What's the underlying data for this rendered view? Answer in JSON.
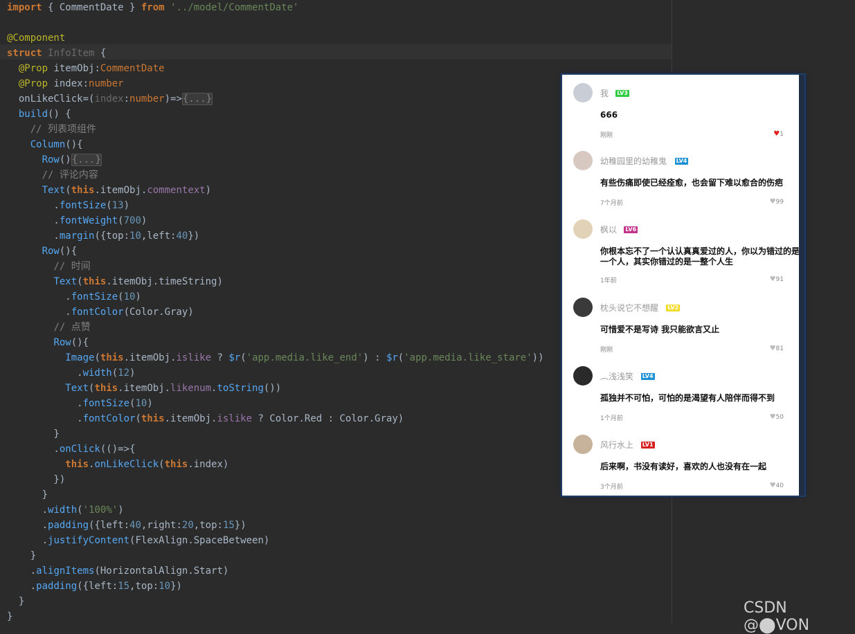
{
  "code_lines": [
    [
      "kw:import",
      " { CommentDate } ",
      "kw:from",
      " ",
      "str:'../model/CommentDate'"
    ],
    [
      ""
    ],
    [
      "ann:@Component"
    ],
    [
      "kw:struct",
      " ",
      "dim:InfoItem",
      " {"
    ],
    [
      "  ",
      "ann:@Prop",
      " itemObj:",
      "type:CommentDate"
    ],
    [
      "  ",
      "ann:@Prop",
      " index:",
      "type:number"
    ],
    [
      "  onLikeClick=(",
      "dim:index",
      ":",
      "type:number",
      ")=>",
      "fold:{...}"
    ],
    [
      "  ",
      "fn:build",
      "() {"
    ],
    [
      "    ",
      "cmt:// 列表项组件"
    ],
    [
      "    ",
      "fn:Column",
      "(){"
    ],
    [
      "      ",
      "fn:Row",
      "()",
      "fold:{...}"
    ],
    [
      "      ",
      "cmt:// 评论内容"
    ],
    [
      "      ",
      "fn:Text",
      "(",
      "kw:this",
      ".itemObj.",
      "prop:commentext",
      ")"
    ],
    [
      "        .",
      "meth:fontSize",
      "(",
      "num:13",
      ")"
    ],
    [
      "        .",
      "meth:fontWeight",
      "(",
      "num:700",
      ")"
    ],
    [
      "        .",
      "meth:margin",
      "({top:",
      "num:10",
      ",left:",
      "num:40",
      "})"
    ],
    [
      "      ",
      "fn:Row",
      "(){"
    ],
    [
      "        ",
      "cmt:// 时间"
    ],
    [
      "        ",
      "fn:Text",
      "(",
      "kw:this",
      ".itemObj.timeString)"
    ],
    [
      "          .",
      "meth:fontSize",
      "(",
      "num:10",
      ")"
    ],
    [
      "          .",
      "meth:fontColor",
      "(Color.Gray)"
    ],
    [
      "        ",
      "cmt:// 点赞"
    ],
    [
      "        ",
      "fn:Row",
      "(){"
    ],
    [
      "          ",
      "fn:Image",
      "(",
      "kw:this",
      ".itemObj.",
      "prop:islike",
      " ? ",
      "fn:$r",
      "(",
      "str:'app.media.like_end'",
      ") : ",
      "fn:$r",
      "(",
      "str:'app.media.like_stare'",
      "))"
    ],
    [
      "            .",
      "meth:width",
      "(",
      "num:12",
      ")"
    ],
    [
      "          ",
      "fn:Text",
      "(",
      "kw:this",
      ".itemObj.",
      "prop:likenum",
      ".",
      "meth:toString",
      "())"
    ],
    [
      "            .",
      "meth:fontSize",
      "(",
      "num:10",
      ")"
    ],
    [
      "            .",
      "meth:fontColor",
      "(",
      "kw:this",
      ".itemObj.",
      "prop:islike",
      " ? Color.Red : Color.Gray)"
    ],
    [
      "        }"
    ],
    [
      "        .",
      "meth:onClick",
      "(()=>{"
    ],
    [
      "          ",
      "kw:this",
      ".",
      "meth:onLikeClick",
      "(",
      "kw:this",
      ".index)"
    ],
    [
      "        })"
    ],
    [
      "      }"
    ],
    [
      "      .",
      "meth:width",
      "(",
      "str:'100%'",
      ")"
    ],
    [
      "      .",
      "meth:padding",
      "({left:",
      "num:40",
      ",right:",
      "num:20",
      ",top:",
      "num:15",
      "})"
    ],
    [
      "      .",
      "meth:justifyContent",
      "(FlexAlign.SpaceBetween)"
    ],
    [
      "    }"
    ],
    [
      "    .",
      "meth:alignItems",
      "(HorizontalAlign.Start)"
    ],
    [
      "    .",
      "meth:padding",
      "({left:",
      "num:15",
      ",top:",
      "num:10",
      "})"
    ],
    [
      "  }"
    ],
    [
      "}"
    ]
  ],
  "comments": [
    {
      "name": "我",
      "level": "LV3",
      "level_color": "#2ecc40",
      "text": "666",
      "time": "刚刚",
      "likes": "1",
      "liked": true,
      "avatar": "#c9cdd6"
    },
    {
      "name": "幼稚园里的幼稚鬼",
      "level": "LV4",
      "level_color": "#1e90d6",
      "text": "有些伤痛即使已经痊愈，也会留下难以愈合的伤疤",
      "time": "7个月前",
      "likes": "99",
      "liked": false,
      "avatar": "#d8c8c2"
    },
    {
      "name": "枫以",
      "level": "LV6",
      "level_color": "#c2328a",
      "text": "你根本忘不了一个认认真真爱过的人，你以为错过的是一个人，其实你错过的是一整个人生",
      "time": "1年前",
      "likes": "91",
      "liked": false,
      "avatar": "#e2d3b8"
    },
    {
      "name": "枕头说它不想醒",
      "level": "LV2",
      "level_color": "#f2dc2a",
      "text": "可惜爱不是写诗 我只能欲言又止",
      "time": "刚刚",
      "likes": "81",
      "liked": false,
      "avatar": "#3a3a3a"
    },
    {
      "name": "︵浅浅笑",
      "level": "LV4",
      "level_color": "#1e90d6",
      "text": "孤独并不可怕，可怕的是渴望有人陪伴而得不到",
      "time": "1个月前",
      "likes": "50",
      "liked": false,
      "avatar": "#2a2a2a"
    },
    {
      "name": "风行水上",
      "level": "LV1",
      "level_color": "#d62020",
      "text": "后来啊，书没有读好，喜欢的人也没有在一起",
      "time": "3个月前",
      "likes": "40",
      "liked": false,
      "avatar": "#c7b29b"
    }
  ],
  "like_colors": {
    "liked": "#e02020",
    "unliked": "#bbbbbb"
  },
  "watermark": "CSDN @⬤VON"
}
